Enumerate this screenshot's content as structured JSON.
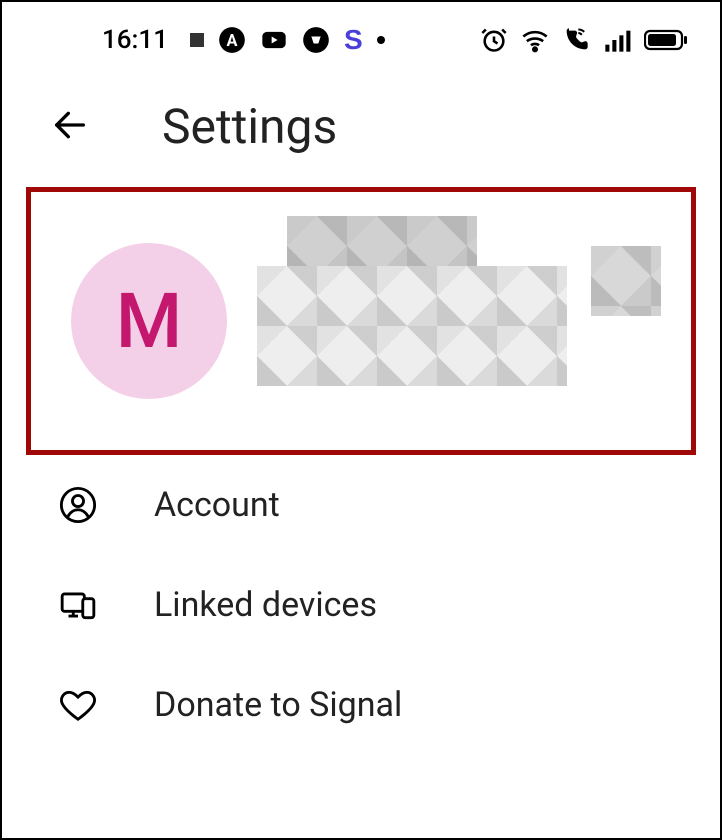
{
  "status_bar": {
    "time": "16:11"
  },
  "header": {
    "title": "Settings"
  },
  "profile": {
    "avatar_letter": "M"
  },
  "menu": {
    "account": "Account",
    "linked_devices": "Linked devices",
    "donate": "Donate to Signal"
  }
}
